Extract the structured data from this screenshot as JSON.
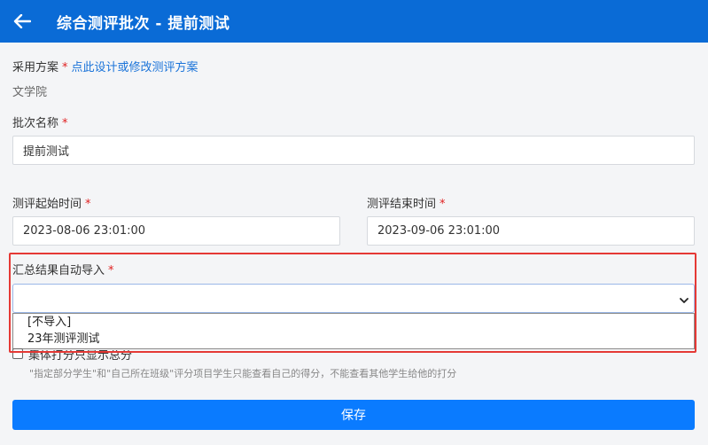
{
  "header": {
    "title": "综合测评批次 - 提前测试",
    "back_icon": "arrow-left-icon"
  },
  "scheme": {
    "label": "采用方案",
    "required_mark": "*",
    "link_text": "点此设计或修改测评方案",
    "value": "文学院"
  },
  "batch_name": {
    "label": "批次名称",
    "required_mark": "*",
    "value": "提前测试"
  },
  "start_time": {
    "label": "测评起始时间",
    "required_mark": "*",
    "value": "2023-08-06 23:01:00"
  },
  "end_time": {
    "label": "测评结束时间",
    "required_mark": "*",
    "value": "2023-09-06 23:01:00"
  },
  "import_result": {
    "label": "汇总结果自动导入",
    "required_mark": "*",
    "selected": "",
    "options": [
      "[不导入]",
      "23年测评测试"
    ]
  },
  "score_option": {
    "label": "集体打分只显示总分",
    "hint": "\"指定部分学生\"和\"自己所在班级\"评分项目学生只能查看自己的得分，不能查看其他学生给他的打分"
  },
  "save_button": {
    "label": "保存"
  },
  "colors": {
    "primary": "#0a6bd6",
    "button": "#0a7bff",
    "required": "#e02020",
    "highlight": "#e53935"
  }
}
